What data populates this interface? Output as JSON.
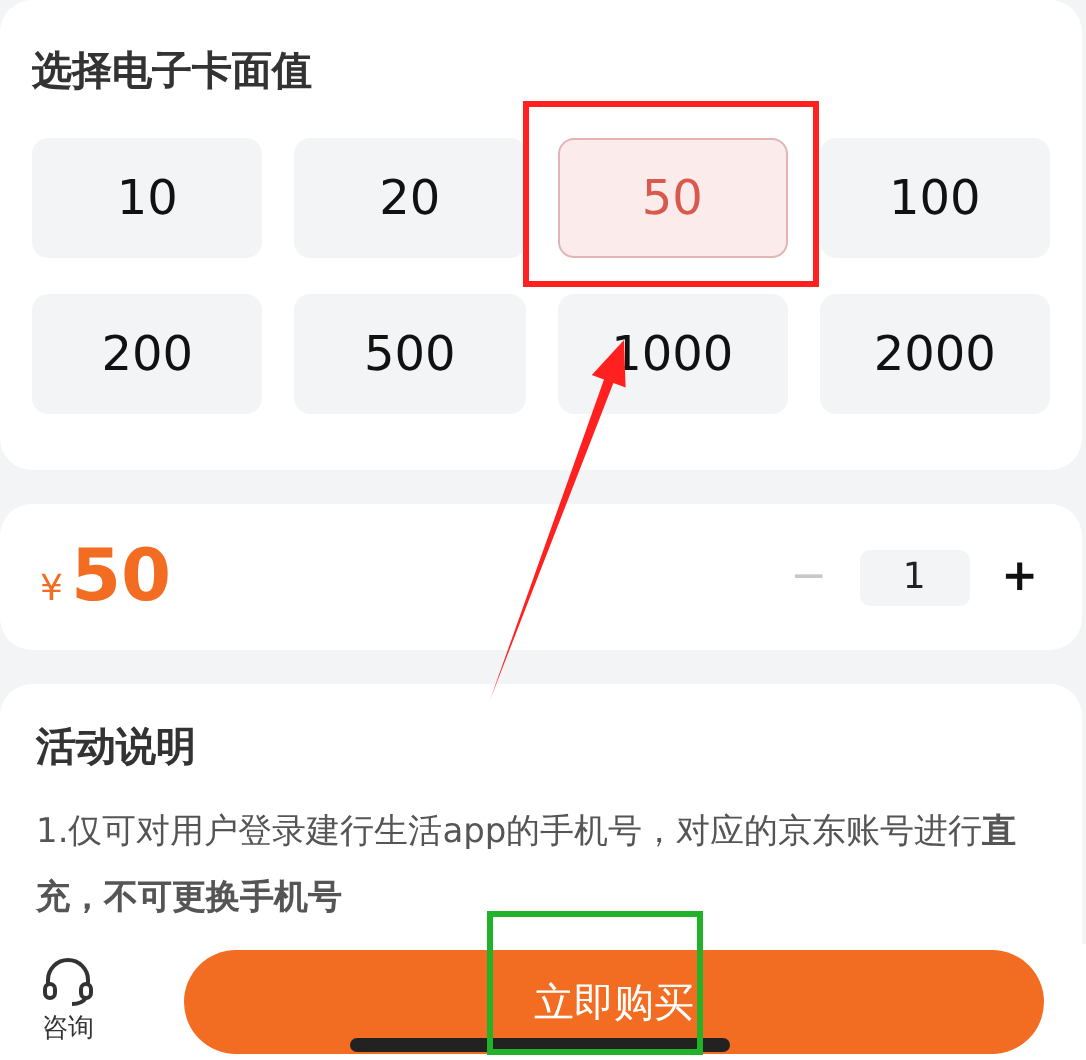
{
  "denomination": {
    "title": "选择电子卡面值",
    "options": [
      {
        "label": "10",
        "selected": false
      },
      {
        "label": "20",
        "selected": false
      },
      {
        "label": "50",
        "selected": true
      },
      {
        "label": "100",
        "selected": false
      },
      {
        "label": "200",
        "selected": false
      },
      {
        "label": "500",
        "selected": false
      },
      {
        "label": "1000",
        "selected": false
      },
      {
        "label": "2000",
        "selected": false
      }
    ]
  },
  "price": {
    "currency": "¥",
    "amount": "50"
  },
  "quantity": {
    "minus": "−",
    "minus_disabled": true,
    "value": "1",
    "plus": "+"
  },
  "activity": {
    "title": "活动说明",
    "text": "1.仅可对用户登录建行生活app的手机号，对应的京东账号进行**直充，不可更换手机号**"
  },
  "bottom_bar": {
    "consult_label": "咨询",
    "buy_button": "立即购买"
  },
  "annotations": [
    {
      "kind": "box",
      "color": "#ff2020"
    },
    {
      "kind": "arrow",
      "color": "#ff2020"
    },
    {
      "kind": "box",
      "color": "#22b22a"
    }
  ]
}
